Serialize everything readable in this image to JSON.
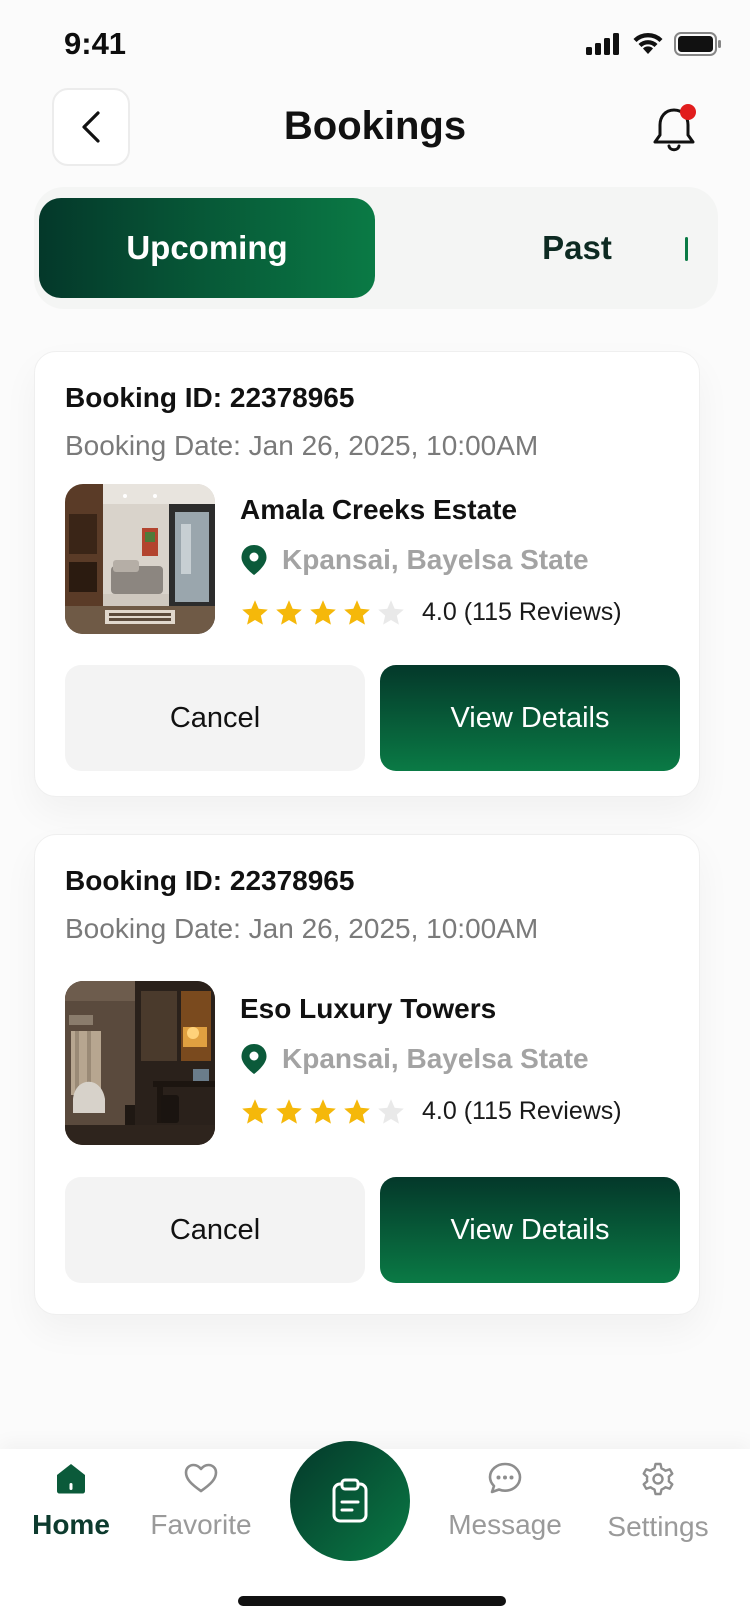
{
  "status_bar": {
    "time": "9:41"
  },
  "header": {
    "title": "Bookings"
  },
  "tabs": [
    {
      "label": "Upcoming",
      "active": true
    },
    {
      "label": "Past",
      "active": false
    }
  ],
  "bookings": [
    {
      "booking_id": "Booking ID: 22378965",
      "booking_date": "Booking Date: Jan 26, 2025, 10:00AM",
      "property_name": "Amala Creeks Estate",
      "location": "Kpansai, Bayelsa State",
      "rating": 4.0,
      "rating_text": "4.0 (115 Reviews)",
      "cancel_label": "Cancel",
      "view_label": "View Details"
    },
    {
      "booking_id": "Booking ID: 22378965",
      "booking_date": "Booking Date: Jan 26, 2025, 10:00AM",
      "property_name": "Eso Luxury Towers",
      "location": "Kpansai, Bayelsa State",
      "rating": 4.0,
      "rating_text": "4.0 (115 Reviews)",
      "cancel_label": "Cancel",
      "view_label": "View Details"
    }
  ],
  "bottom_nav": {
    "items": [
      {
        "label": "Home",
        "icon": "home-icon",
        "active": true
      },
      {
        "label": "Favorite",
        "icon": "heart-icon",
        "active": false
      },
      {
        "label": "Message",
        "icon": "message-icon",
        "active": false
      },
      {
        "label": "Settings",
        "icon": "gear-icon",
        "active": false
      }
    ],
    "center_icon": "clipboard-icon"
  },
  "colors": {
    "brand_dark": "#04382a",
    "brand_green": "#0a7a45",
    "star": "#f5b80a",
    "notification_dot": "#e11d1d"
  }
}
